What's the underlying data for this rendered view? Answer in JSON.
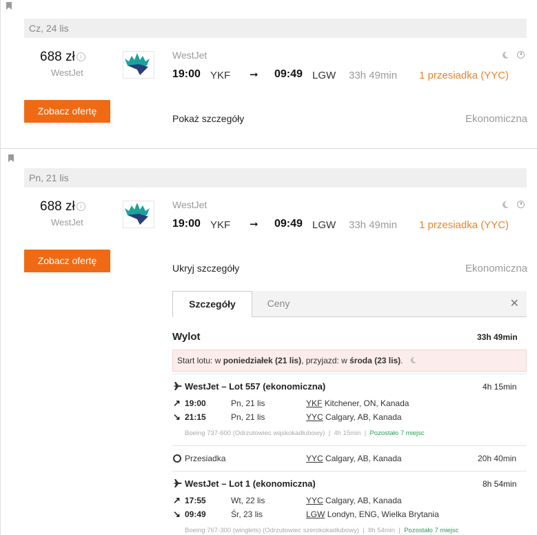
{
  "cards": [
    {
      "date": "Cz, 24 lis",
      "price": "688 zł",
      "airline": "WestJet",
      "offer_label": "Zobacz ofertę",
      "carrier": "WestJet",
      "dep_time": "19:00",
      "dep_code": "YKF",
      "arr_time": "09:49",
      "arr_code": "LGW",
      "duration": "33h 49min",
      "stops": "1 przesiadka (YYC)",
      "details_toggle": "Pokaż szczegóły",
      "cabin": "Ekonomiczna"
    },
    {
      "date": "Pn, 21 lis",
      "price": "688 zł",
      "airline": "WestJet",
      "offer_label": "Zobacz ofertę",
      "carrier": "WestJet",
      "dep_time": "19:00",
      "dep_code": "YKF",
      "arr_time": "09:49",
      "arr_code": "LGW",
      "duration": "33h 49min",
      "stops": "1 przesiadka (YYC)",
      "details_toggle": "Ukryj szczegóły",
      "cabin": "Ekonomiczna"
    }
  ],
  "details": {
    "tab_active": "Szczegóły",
    "tab_other": "Ceny",
    "close": "✕",
    "section_title": "Wylot",
    "section_duration": "33h 49min",
    "notice_prefix": "Start lotu: w ",
    "notice_day1": "poniedziałek (21 lis)",
    "notice_mid": ", przyjazd: w ",
    "notice_day2": "środa (23 lis)",
    "notice_end": ".",
    "leg1": {
      "title": "WestJet – Lot 557 (ekonomiczna)",
      "duration": "4h 15min",
      "dep_time": "19:00",
      "dep_date": "Pn, 21 lis",
      "dep_code": "YKF",
      "dep_place": "Kitchener, ON, Kanada",
      "arr_time": "21:15",
      "arr_date": "Pn, 21 lis",
      "arr_code": "YYC",
      "arr_place": "Calgary, AB, Kanada",
      "aircraft": "Boeing 737-600 (Odrzutowiec wąskokadłubowy)",
      "sep1": "|",
      "leg_dur": "4h 15min",
      "sep2": "|",
      "seats": "Pozostało 7 miejsc"
    },
    "layover": {
      "label": "Przesiadka",
      "code": "YYC",
      "place": "Calgary, AB, Kanada",
      "duration": "20h 40min"
    },
    "leg2": {
      "title": "WestJet – Lot 1 (ekonomiczna)",
      "duration": "8h 54min",
      "dep_time": "17:55",
      "dep_date": "Wt, 22 lis",
      "dep_code": "YYC",
      "dep_place": "Calgary, AB, Kanada",
      "arr_time": "09:49",
      "arr_date": "Śr, 23 lis",
      "arr_code": "LGW",
      "arr_place": "Londyn, ENG, Wielka Brytania",
      "aircraft": "Boeing 767-300 (winglets) (Odrzutowiec szerokokadłubowy)",
      "sep1": "|",
      "leg_dur": "8h 54min",
      "sep2": "|",
      "seats": "Pozostało 7 miejsc"
    }
  },
  "colors": {
    "accent": "#f06a14",
    "stops": "#e8832a",
    "seats": "#2e9a57"
  }
}
